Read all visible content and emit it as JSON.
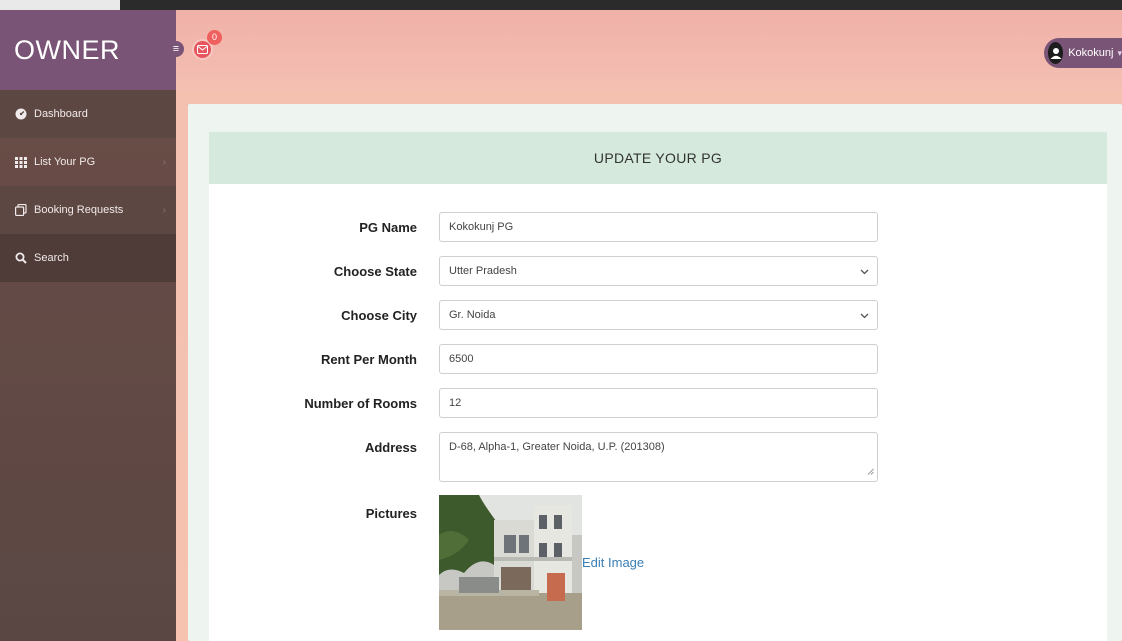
{
  "brand": {
    "title": "OWNER"
  },
  "header": {
    "notifications_count": "0",
    "user_name": "Kokokunj"
  },
  "sidebar": {
    "items": [
      {
        "label": "Dashboard",
        "icon": "dashboard-icon"
      },
      {
        "label": "List Your PG",
        "icon": "grid-icon"
      },
      {
        "label": "Booking Requests",
        "icon": "copy-icon"
      },
      {
        "label": "Search",
        "icon": "search-icon"
      }
    ]
  },
  "form": {
    "heading": "UPDATE YOUR PG",
    "pg_name": {
      "label": "PG Name",
      "value": "Kokokunj PG"
    },
    "state": {
      "label": "Choose State",
      "value": "Utter Pradesh"
    },
    "city": {
      "label": "Choose City",
      "value": "Gr. Noida"
    },
    "rent": {
      "label": "Rent Per Month",
      "value": "6500"
    },
    "rooms": {
      "label": "Number of Rooms",
      "value": "12"
    },
    "address": {
      "label": "Address",
      "value": "D-68,  Alpha-1,  Greater Noida, U.P. (201308)"
    },
    "pictures": {
      "label": "Pictures",
      "edit_label": "Edit Image"
    }
  },
  "colors": {
    "brand": "#7a5476",
    "header": "#f0b1a8",
    "sidebar": "#6a4c47",
    "card_head": "#d6e9dd",
    "link": "#3a7fb5"
  }
}
